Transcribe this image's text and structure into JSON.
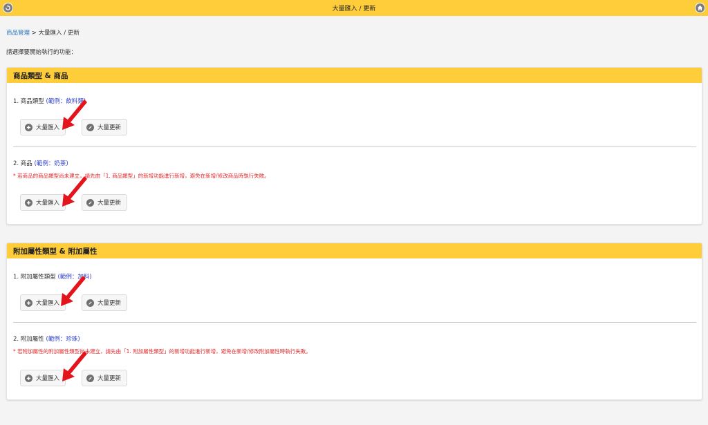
{
  "topbar": {
    "title": "大量匯入 / 更新",
    "back_icon": "back-icon",
    "home_icon": "home-icon"
  },
  "breadcrumb": {
    "link": "商品管理",
    "separator": ">",
    "current": "大量匯入 / 更新"
  },
  "prompt": "請選擇要開始執行的功能：",
  "panels": [
    {
      "header": "商品類型 & 商品",
      "sections": [
        {
          "title": "1. 商品類型",
          "example": "(範例：飲料類)",
          "warning": "",
          "import_label": "大量匯入",
          "update_label": "大量更新"
        },
        {
          "title": "2. 商品",
          "example": "(範例：奶茶)",
          "warning": "* 若商品的商品類型尚未建立，請先由「1. 商品類型」的新增功能進行新增，避免在新增/修改商品時執行失敗。",
          "import_label": "大量匯入",
          "update_label": "大量更新"
        }
      ]
    },
    {
      "header": "附加屬性類型 & 附加屬性",
      "sections": [
        {
          "title": "1. 附加屬性類型",
          "example": "(範例：加料)",
          "warning": "",
          "import_label": "大量匯入",
          "update_label": "大量更新"
        },
        {
          "title": "2. 附加屬性",
          "example": "(範例：珍珠)",
          "warning": "* 若附加屬性的附加屬性類型尚未建立，請先由「1. 附加屬性類型」的新增功能進行新增，避免在新增/修改附加屬性時執行失敗。",
          "import_label": "大量匯入",
          "update_label": "大量更新"
        }
      ]
    }
  ],
  "colors": {
    "accent": "#ffcd3a",
    "link": "#2b78c5",
    "example": "#2b3cc8",
    "warning": "#e4282b",
    "arrow": "#e3141b"
  }
}
